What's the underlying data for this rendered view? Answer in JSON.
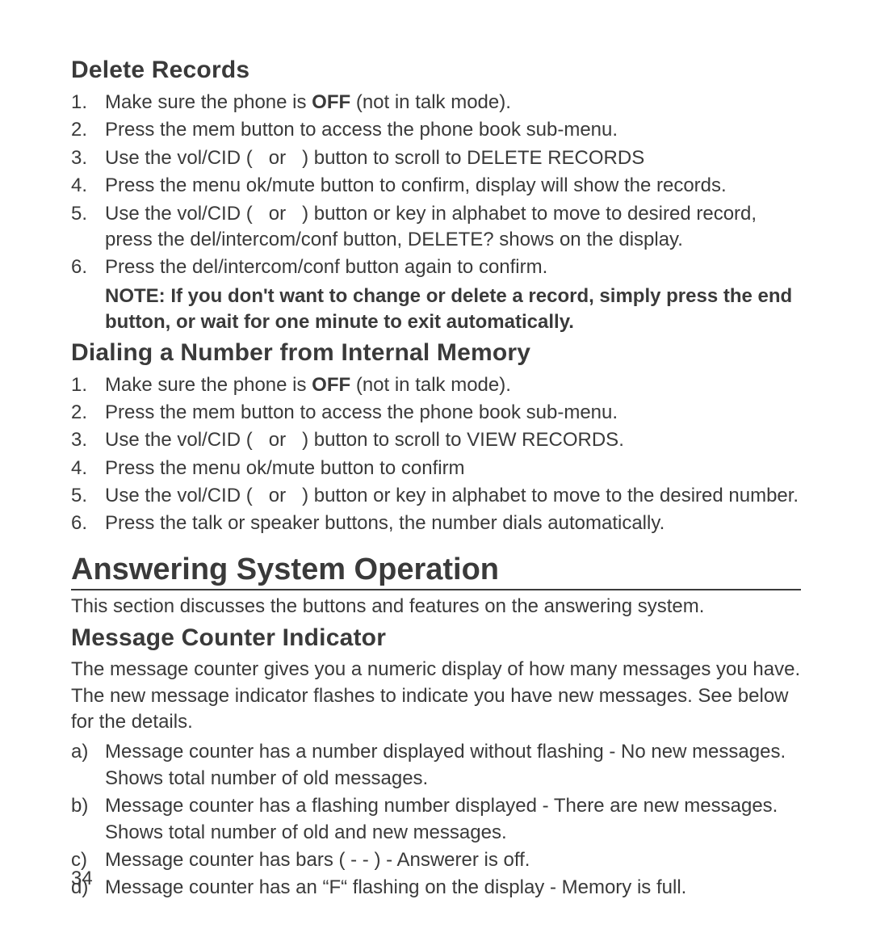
{
  "page_number": "34",
  "sections": {
    "delete_records": {
      "heading": "Delete Records",
      "items": [
        {
          "pre": "Make sure the phone is ",
          "bold": "OFF",
          "post": " (not in talk mode)."
        },
        "Press the mem button to access the phone book sub-menu.",
        {
          "pre": "Use the vol/CID (   or   ) button to scroll to ",
          "caps": "DELETE RECORDS"
        },
        "Press the menu ok/mute  button to confirm, display will show the records.",
        {
          "pre": "Use the vol/CID (   or   ) button or key in alphabet to move to desired record, press the del/intercom/conf button, ",
          "caps": "DELETE?",
          "post": " shows on the display."
        },
        "Press the del/intercom/conf button again to confirm."
      ],
      "note": "NOTE: If you don't want to change or delete a record, simply press the end button, or wait for one minute to exit automatically."
    },
    "dialing": {
      "heading": "Dialing a Number from Internal Memory",
      "items": [
        {
          "pre": "Make sure the phone is ",
          "bold": "OFF",
          "post": " (not in talk mode)."
        },
        "Press the mem button to access the phone book sub-menu.",
        {
          "pre": "Use the vol/CID (   or   ) button to scroll to  ",
          "caps": "VIEW RECORDS",
          "post": "."
        },
        "Press the menu ok/mute  button to confirm",
        "Use the vol/CID (   or   ) button or key in alphabet to move to the desired number.",
        "Press the talk or speaker buttons, the number dials automatically."
      ]
    },
    "answering": {
      "heading": "Answering System Operation",
      "intro": "This section discusses the buttons and features on the answering system."
    },
    "mci": {
      "heading": "Message Counter Indicator",
      "intro": "The message counter gives you a numeric display of how many messages you have. The new message indicator flashes to indicate you have new messages. See below for the details.",
      "items": [
        "Message counter has a number displayed without flashing - No new messages. Shows total number of old messages.",
        "Message counter has a flashing number displayed - There are new messages. Shows total number of old and new messages.",
        "Message counter has bars ( - - ) - Answerer is off.",
        "Message counter has an “F“ flashing on the display - Memory is full."
      ]
    }
  }
}
